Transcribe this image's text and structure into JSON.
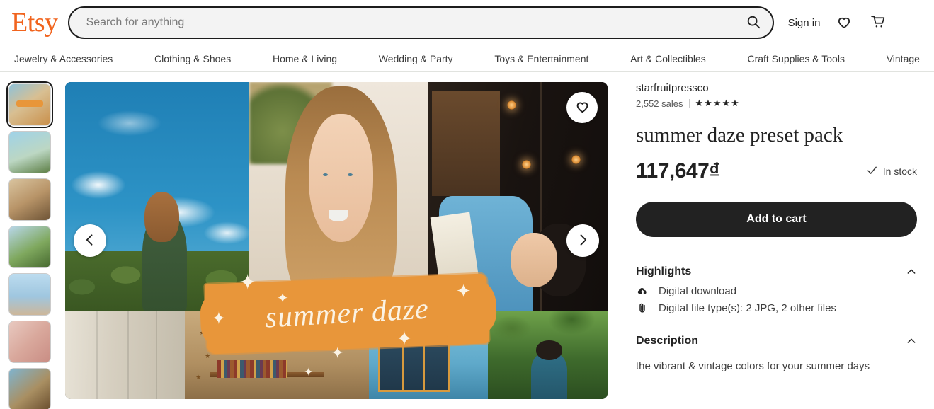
{
  "header": {
    "logo": "Etsy",
    "search": {
      "value": "",
      "placeholder": "Search for anything",
      "icon": "search-icon"
    },
    "sign_in": "Sign in",
    "favorites_icon": "heart-icon",
    "cart_icon": "shopping-cart-icon"
  },
  "categories": [
    "Jewelry & Accessories",
    "Clothing & Shoes",
    "Home & Living",
    "Wedding & Party",
    "Toys & Entertainment",
    "Art & Collectibles",
    "Craft Supplies & Tools",
    "Vintage"
  ],
  "gallery": {
    "selected_index": 0,
    "thumbnails": [
      {
        "label": "summer daze collage cover"
      },
      {
        "label": "honey preset preview"
      },
      {
        "label": "nectarine preset preview"
      },
      {
        "label": "summer preset preview"
      },
      {
        "label": "nectarine beach preview"
      },
      {
        "label": "nectar before and after"
      },
      {
        "label": "fresh cafe preview"
      }
    ],
    "overlay_text": "summer daze",
    "banner_color": "#E8963A",
    "favorite_icon": "heart-icon",
    "prev_icon": "chevron-left-icon",
    "next_icon": "chevron-right-icon"
  },
  "product": {
    "shop_name": "starfruitpressco",
    "sales": "2,552 sales",
    "rating_stars": "★★★★★",
    "title": "summer daze preset pack",
    "price": "117,647₫",
    "stock_label": "In stock",
    "stock_icon": "check-icon",
    "add_to_cart": "Add to cart"
  },
  "highlights": {
    "title": "Highlights",
    "collapse_icon": "chevron-up-icon",
    "items": [
      {
        "icon": "cloud-download-icon",
        "text": "Digital download"
      },
      {
        "icon": "paperclip-icon",
        "text": "Digital file type(s): 2 JPG, 2 other files"
      }
    ]
  },
  "description": {
    "title": "Description",
    "collapse_icon": "chevron-up-icon",
    "body": "the vibrant & vintage colors for your summer days"
  }
}
